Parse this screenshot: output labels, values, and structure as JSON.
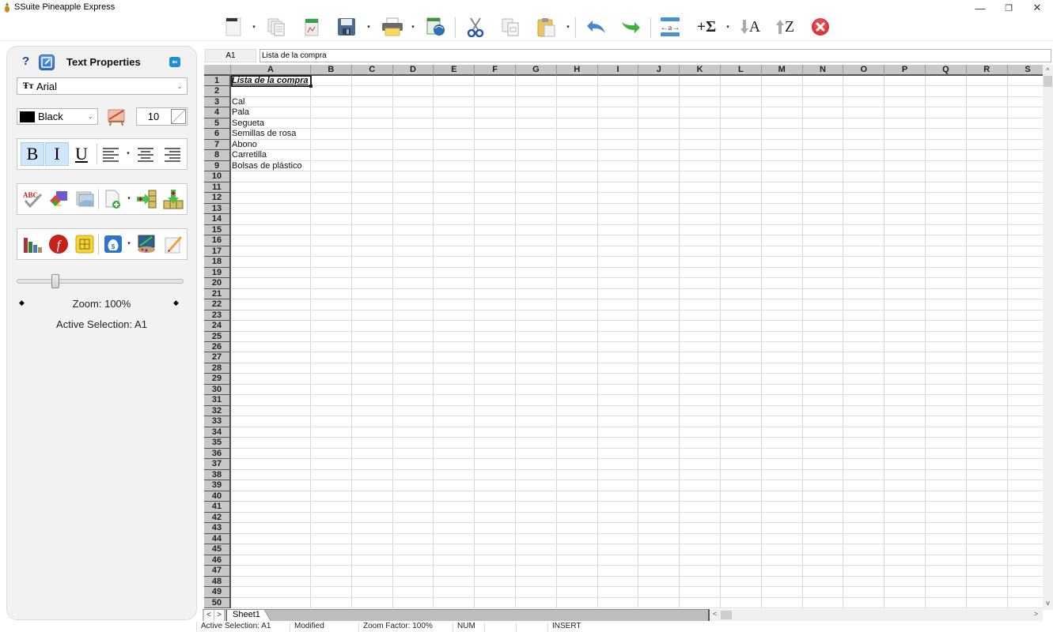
{
  "window": {
    "title": "SSuite Pineapple Express",
    "minimize": "—",
    "restore": "❐",
    "close": "✕"
  },
  "toolbar": {
    "items": [
      {
        "name": "new-document",
        "has_dropdown": true
      },
      {
        "name": "duplicate"
      },
      {
        "name": "spreadsheet-template"
      },
      {
        "name": "save",
        "has_dropdown": true
      },
      {
        "name": "print",
        "has_dropdown": true
      },
      {
        "name": "export-web"
      },
      {
        "name": "cut"
      },
      {
        "name": "copy"
      },
      {
        "name": "paste",
        "has_dropdown": true
      },
      {
        "name": "undo"
      },
      {
        "name": "redo"
      },
      {
        "name": "fit-text"
      },
      {
        "name": "autosum",
        "has_dropdown": true
      },
      {
        "name": "sort-ascending"
      },
      {
        "name": "sort-descending"
      },
      {
        "name": "exit"
      }
    ],
    "sum_glyph": "+Σ",
    "sort_asc_glyph": "A",
    "sort_desc_glyph": "Z",
    "fit_text_glyph": "←a→",
    "dropdown_glyph": "▾"
  },
  "panel": {
    "help_glyph": "?",
    "title": "Text Properties",
    "close_glyph": "⇐",
    "font": {
      "icon_glyph": "Ŧт",
      "value": "Arial"
    },
    "color": {
      "value": "Black",
      "swatch": "#000000"
    },
    "font_size": "10",
    "format": {
      "bold": "B",
      "italic": "I",
      "underline": "U",
      "bold_active": true,
      "italic_active": true
    },
    "zoom_slider": {
      "value_percent": 100,
      "position_fraction": 0.22
    },
    "zoom_label": "Zoom: 100%",
    "active_selection": "Active Selection: A1",
    "chevron": "⌄"
  },
  "formula_bar": {
    "cell_ref": "A1",
    "content": "Lista de la compra"
  },
  "sheet": {
    "columns": [
      "A",
      "B",
      "C",
      "D",
      "E",
      "F",
      "G",
      "H",
      "I",
      "J",
      "K",
      "L",
      "M",
      "N",
      "O",
      "P",
      "Q",
      "R",
      "S"
    ],
    "visible_rows": 50,
    "selected_cell": "A1",
    "cells": [
      {
        "row": 1,
        "col": "A",
        "value": "Lista de la compra",
        "style": "title"
      },
      {
        "row": 3,
        "col": "A",
        "value": "Cal"
      },
      {
        "row": 4,
        "col": "A",
        "value": "Pala"
      },
      {
        "row": 5,
        "col": "A",
        "value": "Segueta"
      },
      {
        "row": 6,
        "col": "A",
        "value": "Semillas de rosa"
      },
      {
        "row": 7,
        "col": "A",
        "value": "Abono"
      },
      {
        "row": 8,
        "col": "A",
        "value": "Carretilla"
      },
      {
        "row": 9,
        "col": "A",
        "value": "Bolsas de plástico"
      }
    ],
    "tabs": [
      {
        "label": "Sheet1",
        "active": true
      }
    ],
    "tab_prev": "<",
    "tab_next": ">"
  },
  "scrollbars": {
    "up": "^",
    "down": "v",
    "left": "<",
    "right": ">"
  },
  "statusbar": {
    "items": [
      "Active Selection: A1",
      "Modified",
      "Zoom Factor: 100%",
      "NUM",
      "",
      "",
      "INSERT"
    ]
  }
}
